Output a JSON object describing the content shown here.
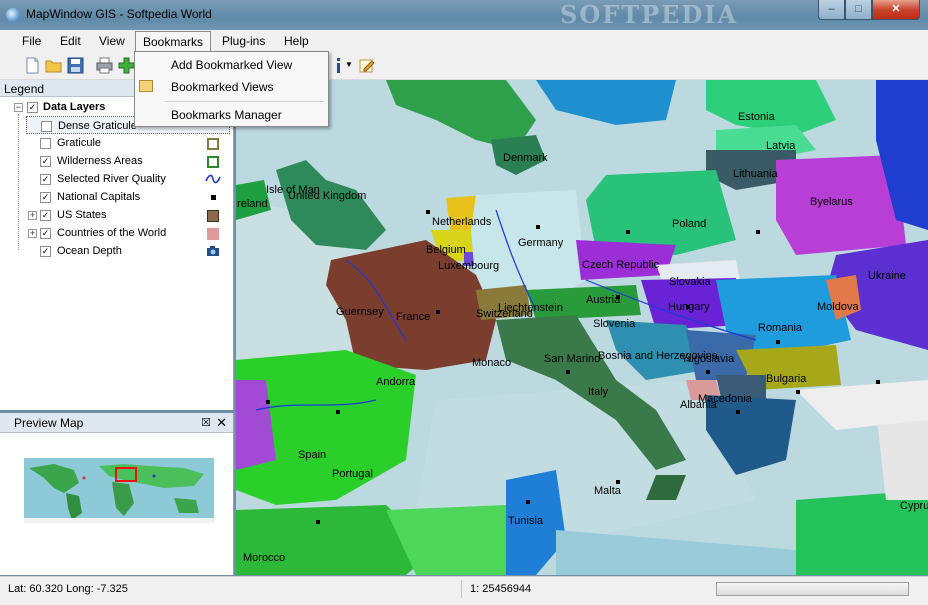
{
  "window": {
    "title": "MapWindow GIS  - Softpedia World",
    "watermark": "SOFTPEDIA"
  },
  "menu": {
    "items": [
      "File",
      "Edit",
      "View",
      "Bookmarks",
      "Plug-ins",
      "Help"
    ],
    "active": "Bookmarks"
  },
  "bookmarks_menu": {
    "items": [
      "Add Bookmarked View",
      "Bookmarked Views",
      "Bookmarks Manager"
    ]
  },
  "legend": {
    "title": "Legend",
    "group": "Data Layers",
    "layers": [
      {
        "name": "Dense Graticule",
        "checked": false,
        "symbol": "none"
      },
      {
        "name": "Graticule",
        "checked": false,
        "symbol": "olive-square-outline"
      },
      {
        "name": "Wilderness Areas",
        "checked": true,
        "symbol": "green-square-outline"
      },
      {
        "name": "Selected River Quality",
        "checked": true,
        "symbol": "blue-wave-line"
      },
      {
        "name": "National Capitals",
        "checked": true,
        "symbol": "black-dot"
      },
      {
        "name": "US States",
        "checked": true,
        "symbol": "brown-fill-square",
        "expandable": true
      },
      {
        "name": "Countries of the World",
        "checked": true,
        "symbol": "pink-fill-square",
        "expandable": true
      },
      {
        "name": "Ocean Depth",
        "checked": true,
        "symbol": "raster-icon"
      }
    ]
  },
  "preview": {
    "title": "Preview Map"
  },
  "map": {
    "labels": [
      "Estonia",
      "Latvia",
      "Denmark",
      "Lithuania",
      "Byelarus",
      "Isle of Man",
      "United Kingdom",
      "Ireland",
      "Netherlands",
      "Poland",
      "Belgium",
      "Germany",
      "Luxembourg",
      "Czech Republic",
      "Ukraine",
      "Slovakia",
      "Austria",
      "Hungary",
      "Moldova",
      "Liechtenstein",
      "Switzerland",
      "Guernsey",
      "France",
      "Slovenia",
      "Romania",
      "Bosnia and Herzegovina",
      "Yugoslavia",
      "San Marino",
      "Monaco",
      "Bulgaria",
      "Andorra",
      "Italy",
      "Macedonia",
      "Albania",
      "Spain",
      "Portugal",
      "Malta",
      "Tunisia",
      "Morocco",
      "Cyprus"
    ]
  },
  "status": {
    "coords": "Lat: 60.320 Long: -7.325",
    "scale": "1: 25456944"
  }
}
